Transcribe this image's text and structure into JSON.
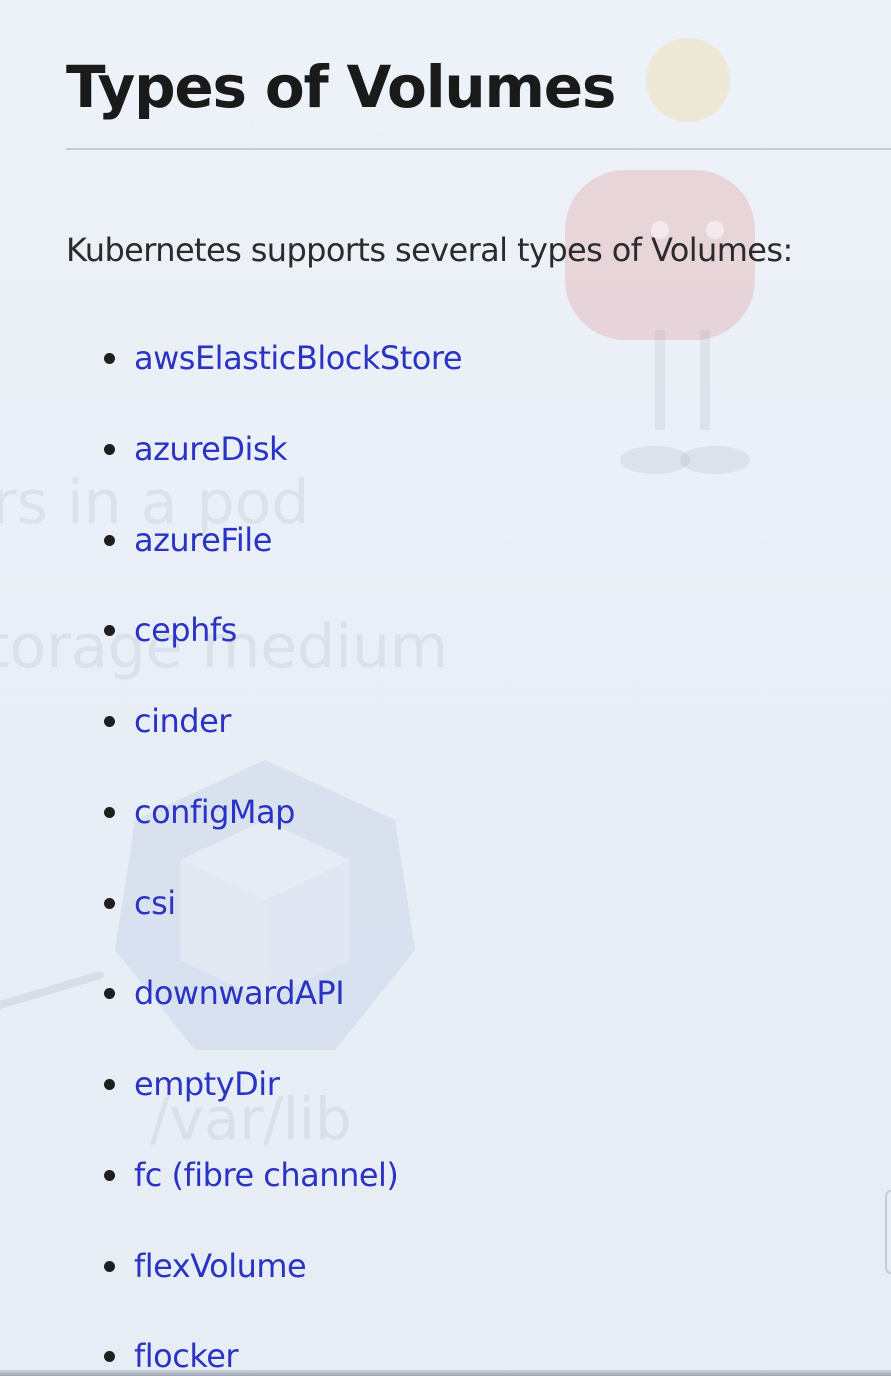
{
  "page": {
    "title": "Types of Volumes",
    "intro": "Kubernetes supports several types of Volumes:"
  },
  "volumes": [
    "awsElasticBlockStore",
    "azureDisk",
    "azureFile",
    "cephfs",
    "cinder",
    "configMap",
    "csi",
    "downwardAPI",
    "emptyDir",
    "fc (fibre channel)",
    "flexVolume",
    "flocker"
  ],
  "colors": {
    "background": "#edf2f8",
    "heading": "#1a1a1a",
    "text": "#2b2b2b",
    "link": "#2a33c4",
    "rule": "#c9ced6"
  }
}
